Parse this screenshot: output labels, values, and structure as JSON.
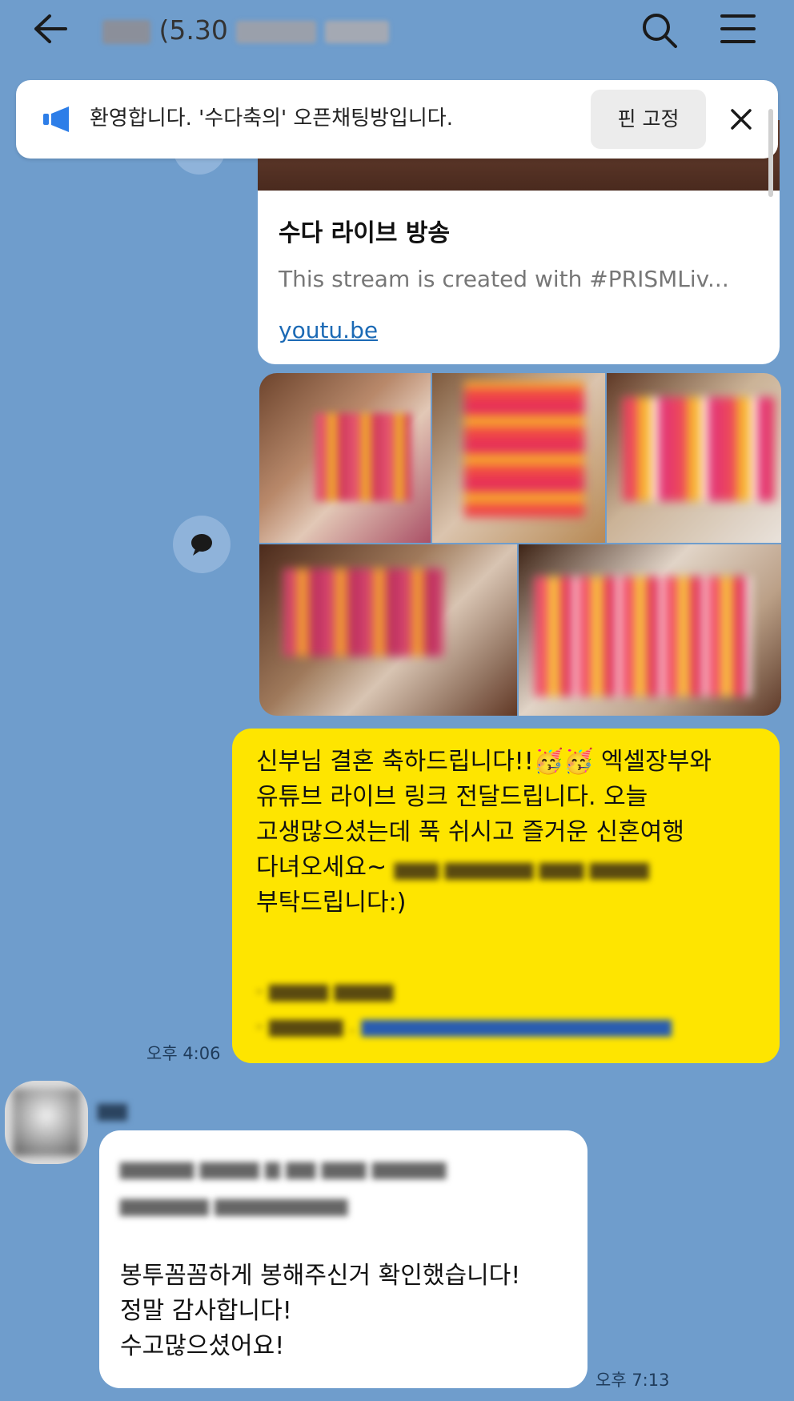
{
  "header": {
    "title": "5.30",
    "back_icon": "arrow-left-icon",
    "search_icon": "search-icon",
    "menu_icon": "hamburger-menu-icon"
  },
  "notice": {
    "text": "환영합니다. '수다축의' 오픈채팅방입니다.",
    "pin_label": "핀 고정",
    "icon": "megaphone-icon",
    "close_icon": "close-icon"
  },
  "link_preview": {
    "title": "수다 라이브 방송",
    "description": "This stream is created with #PRISMLiv...",
    "url": "youtu.be"
  },
  "outgoing_message": {
    "lines": [
      "신부님 결혼 축하드립니다!!🥳🥳 엑셀장부와",
      "유튜브 라이브 링크 전달드립니다. 오늘",
      "고생많으셨는데 푹 쉬시고 즐거운 신혼여행",
      "다녀오세요~",
      "부탁드립니다:)"
    ],
    "time": "오후 4:06"
  },
  "incoming_message": {
    "lines": [
      "봉투꼼꼼하게 봉해주신거 확인했습니다!",
      "정말 감사합니다!",
      "수고많으셨어요!"
    ],
    "time": "오후 7:13"
  },
  "colors": {
    "chat_background": "#6f9dcc",
    "my_bubble": "#fee500",
    "their_bubble": "#ffffff",
    "link": "#1c6ab5",
    "notice_icon": "#2d7ee8"
  }
}
